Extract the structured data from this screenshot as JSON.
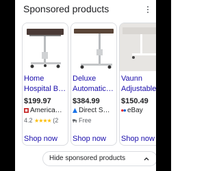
{
  "header": {
    "title": "Sponsored products",
    "menu_icon": "more-vert-icon"
  },
  "products": [
    {
      "title_line1": "Home",
      "title_line2": "Hospital Be…",
      "price": "$199.97",
      "seller": "America…",
      "seller_icon": "store-logo-icon",
      "rating": "4.2",
      "stars": "★★★★",
      "review_count": "(2",
      "shop_label": "Shop now"
    },
    {
      "title_line1": "Deluxe",
      "title_line2": "Automatic…",
      "price": "$384.99",
      "seller": "Direct S…",
      "seller_icon": "store-logo-icon",
      "shipping": "Free",
      "shipping_icon": "delivery-truck-icon",
      "shop_label": "Shop now"
    },
    {
      "title_line1": "Vaunn",
      "title_line2": "Adjustable…",
      "price": "$150.49",
      "seller": "eBay",
      "seller_icon": "ebay-logo-icon",
      "shop_label": "Shop now"
    }
  ],
  "footer": {
    "hide_label": "Hide sponsored products",
    "hide_icon": "chevron-up-icon"
  },
  "colors": {
    "link": "#1a0dab",
    "text": "#202124",
    "muted": "#5f6368",
    "star": "#fbbc04",
    "border": "#dadce0"
  }
}
